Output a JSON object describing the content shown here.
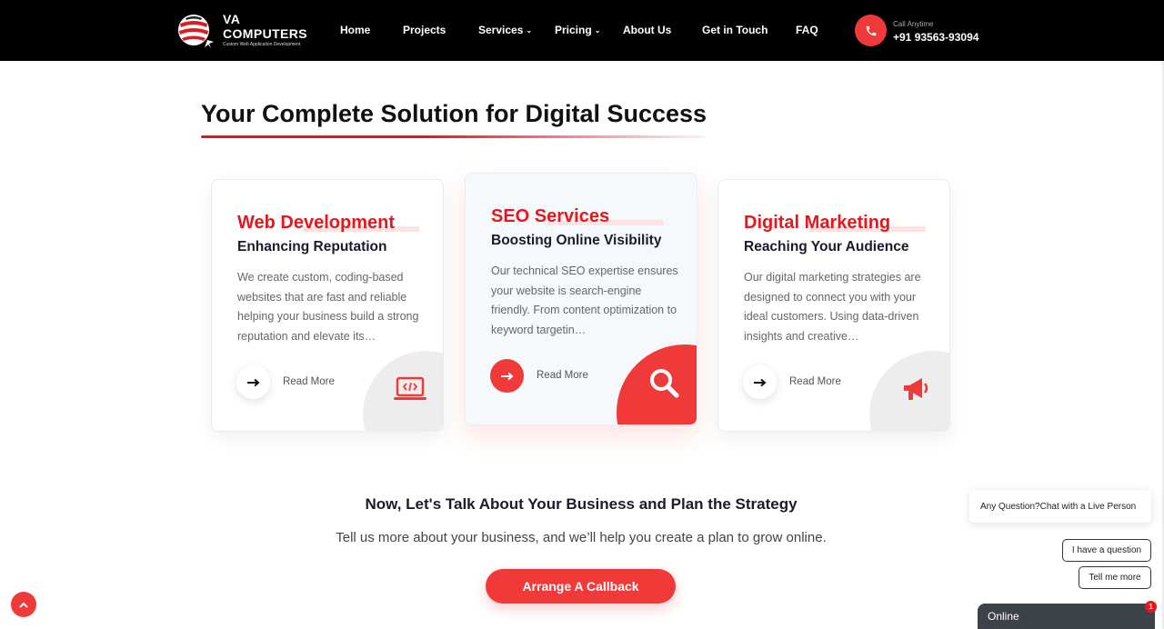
{
  "header": {
    "logo": {
      "line1": "VA",
      "line2": "COMPUTERS",
      "tagline": "Custom Web Application Development"
    },
    "nav": [
      {
        "label": "Home"
      },
      {
        "label": "Projects"
      },
      {
        "label": "Services",
        "dropdown": true
      },
      {
        "label": "Pricing",
        "dropdown": true
      },
      {
        "label": "About Us"
      },
      {
        "label": "Get in Touch"
      },
      {
        "label": "FAQ"
      }
    ],
    "call": {
      "label": "Call Anytime",
      "number": "+91 93563-93094",
      "icon": "phone-icon"
    }
  },
  "section": {
    "title": "Your Complete Solution for Digital Success"
  },
  "cards": [
    {
      "title": "Web Development",
      "subtitle": "Enhancing Reputation",
      "description": "We create custom, coding-based websites that are fast and reliable helping your business build a strong reputation and elevate its…",
      "read_more": "Read More",
      "icon": "laptop-code-icon"
    },
    {
      "title": "SEO Services",
      "subtitle": "Boosting Online Visibility",
      "description": "Our technical SEO expertise ensures your website is search-engine friendly. From content optimization to keyword targetin…",
      "read_more": "Read More",
      "icon": "search-icon"
    },
    {
      "title": "Digital Marketing",
      "subtitle": "Reaching Your Audience",
      "description": "Our digital marketing strategies are designed to connect you with your ideal customers. Using data-driven insights and creative…",
      "read_more": "Read More",
      "icon": "megaphone-icon"
    }
  ],
  "cta": {
    "heading": "Now, Let's Talk About Your Business and Plan the Strategy",
    "text": "Tell us more about your business, and we’ll help you create a plan to grow online.",
    "button": "Arrange A Callback"
  },
  "chat": {
    "bubble": "Any Question?Chat with a Live Person",
    "options": [
      "I have a question",
      "Tell me more"
    ],
    "status": "Online",
    "badge": "1"
  },
  "colors": {
    "accent": "#f03a3a",
    "brand_red": "#e8161c",
    "header_bg": "#000000"
  }
}
